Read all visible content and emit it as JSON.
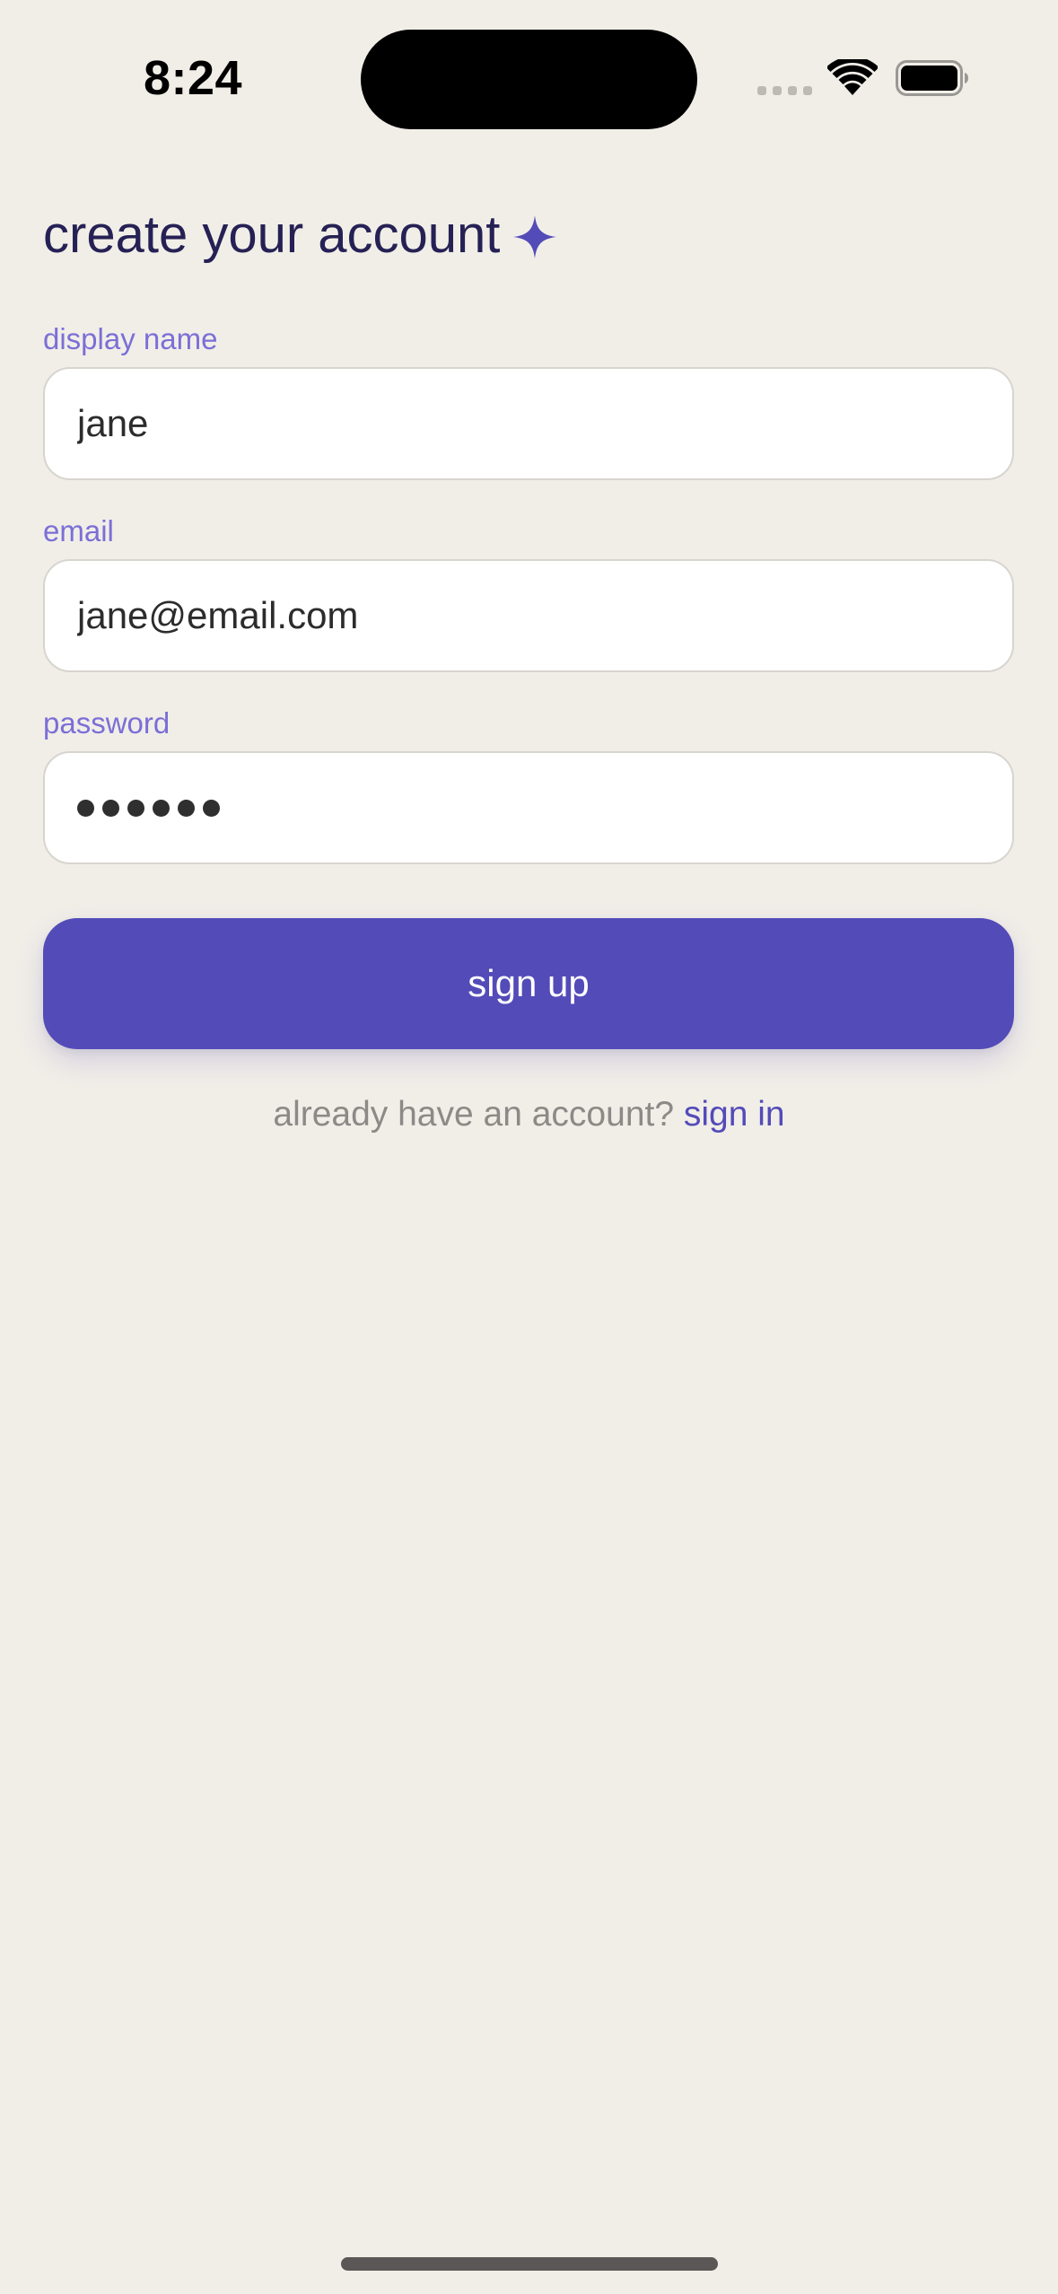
{
  "status_bar": {
    "time": "8:24",
    "icons": [
      "signal-icon",
      "wifi-icon",
      "battery-icon"
    ]
  },
  "header": {
    "title": "create your account",
    "title_icon": "sparkle-icon"
  },
  "form": {
    "display_name": {
      "label": "display name",
      "value": "jane"
    },
    "email": {
      "label": "email",
      "value": "jane@email.com"
    },
    "password": {
      "label": "password",
      "masked_length": 6
    }
  },
  "actions": {
    "signup_label": "sign up",
    "signin_prompt": "already have an account?",
    "signin_link": "sign in"
  },
  "colors": {
    "background": "#f1eee8",
    "accent": "#534bb8",
    "title": "#262154",
    "label": "#7b6fd6",
    "muted_text": "#8c8a87"
  }
}
